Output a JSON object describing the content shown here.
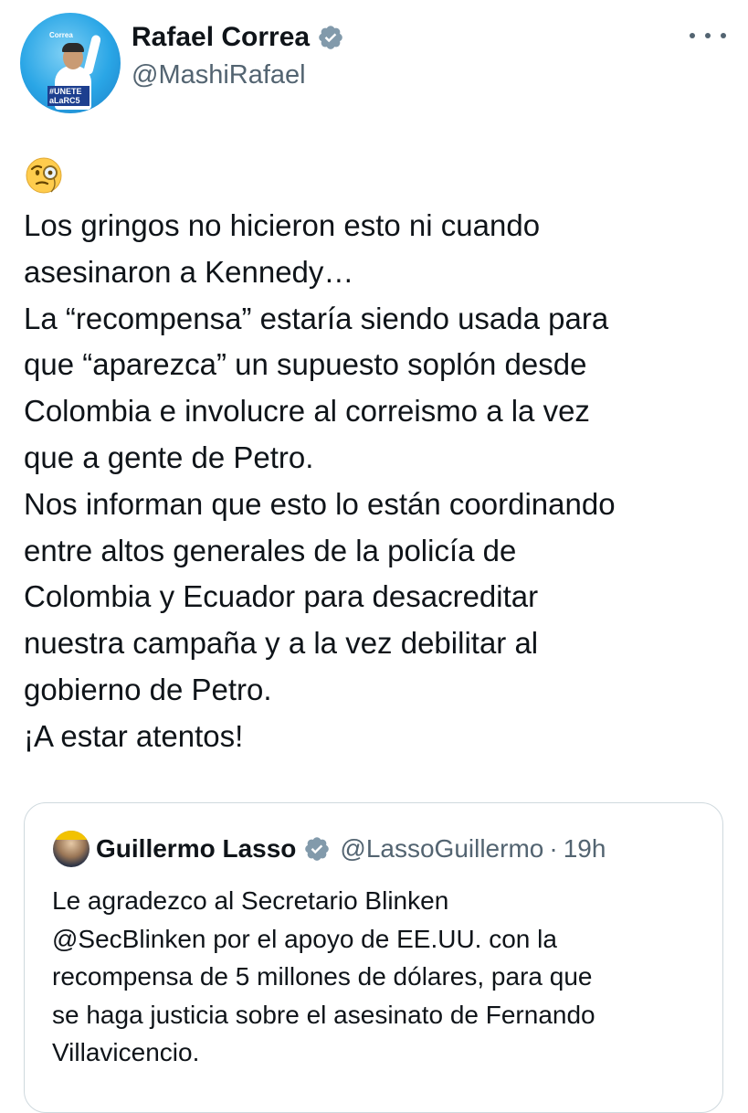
{
  "tweet": {
    "author_name": "Rafael Correa",
    "author_handle": "@MashiRafael",
    "avatar_logo_text": "Correa",
    "avatar_tag_text": "#UNETE aLaRC5",
    "emoji": "monocle-face-emoji",
    "text": "Los gringos no hicieron esto ni cuando\nasesinaron a Kennedy…\nLa “recompensa” estaría siendo usada para\nque “aparezca” un supuesto soplón desde\nColombia e involucre al correismo a la vez\nque a gente de Petro.\nNos informan  que esto lo están coordinando\nentre altos generales de la policía de\nColombia y Ecuador para desacreditar\nnuestra campaña y a la vez debilitar al\ngobierno de Petro.\n¡A estar atentos!",
    "icons": {
      "verified": "verified-badge-icon",
      "more": "more-options-icon"
    }
  },
  "quoted": {
    "author_name": "Guillermo Lasso",
    "author_handle": "@LassoGuillermo",
    "separator": "·",
    "time": "19h",
    "text": "Le agradezco al Secretario Blinken\n@SecBlinken por el apoyo de EE.UU. con la\nrecompensa de 5 millones de dólares, para que\nse haga justicia sobre el asesinato de Fernando\nVillavicencio."
  },
  "colors": {
    "text": "#0f1419",
    "secondary": "#536471",
    "verified": "#829aab",
    "border": "#cfd9de"
  }
}
